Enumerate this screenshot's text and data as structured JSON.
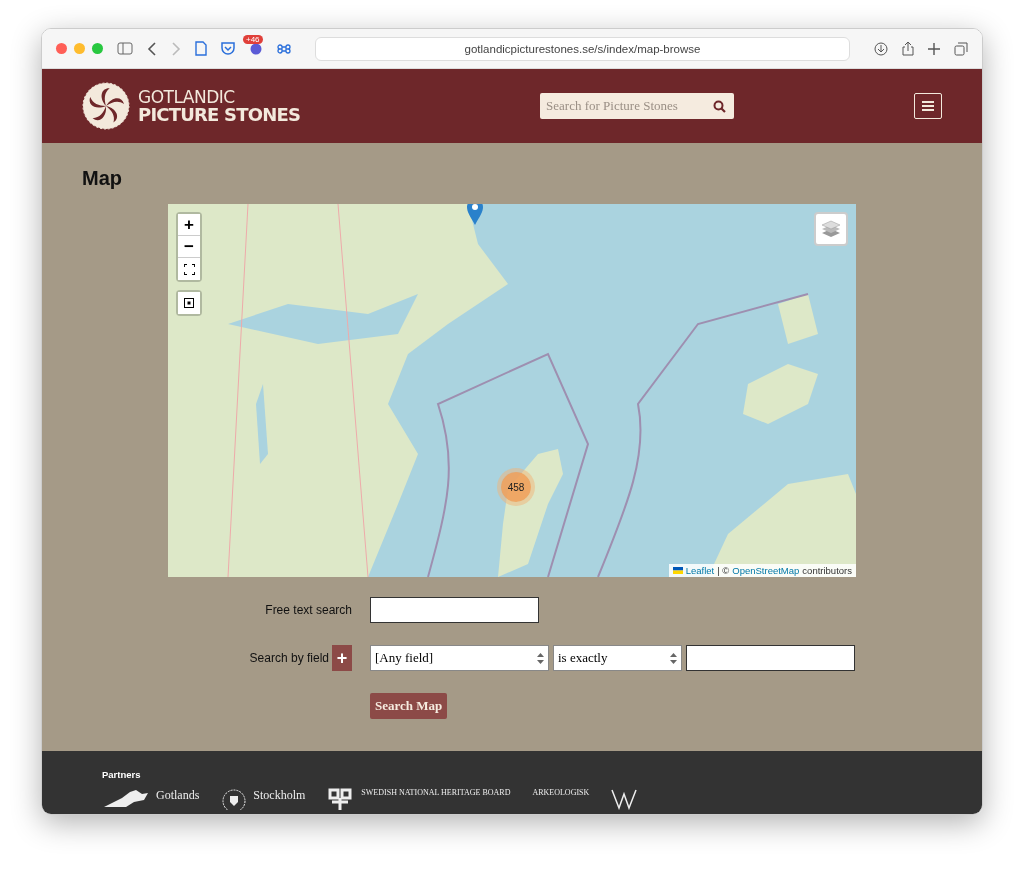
{
  "browser": {
    "url": "gotlandicpicturestones.se/s/index/map-browse",
    "extension_badge": "+46"
  },
  "header": {
    "logo_top": "GOTLANDIC",
    "logo_bottom": "PICTURE STONES",
    "search": {
      "placeholder": "Search for Picture Stones"
    }
  },
  "page_title": "Map",
  "map": {
    "zoom_in": "+",
    "zoom_out": "−",
    "cluster_count": "458",
    "attribution": {
      "leaflet": "Leaflet",
      "separator": "| ©",
      "osm": "OpenStreetMap",
      "suffix": "contributors"
    }
  },
  "form": {
    "free_text_label": "Free text search",
    "field_label": "Search by field",
    "add": "+",
    "field_select": "[Any field]",
    "operator_select": "is exactly",
    "submit": "Search Map"
  },
  "footer": {
    "heading": "Partners",
    "partners": [
      {
        "kind": "rider",
        "name": "Gotlands"
      },
      {
        "kind": "seal",
        "name": "Stockholm"
      },
      {
        "kind": "heritage",
        "name": "SWEDISH NATIONAL HERITAGE BOARD"
      },
      {
        "kind": "museum",
        "name": "ARKEOLOGISK"
      },
      {
        "kind": "monogram"
      }
    ]
  }
}
